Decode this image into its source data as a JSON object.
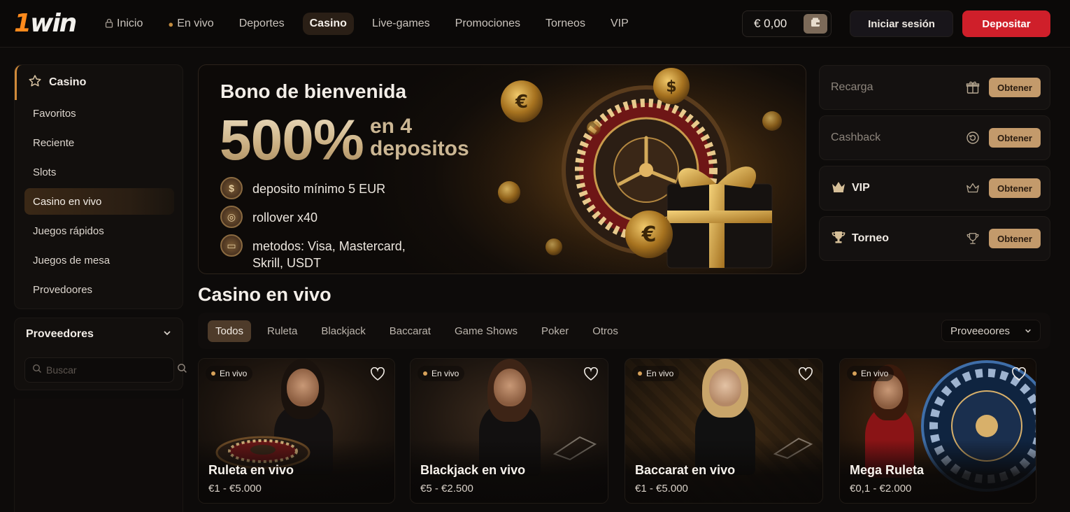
{
  "header": {
    "logo_text_one": "1",
    "logo_text_win": "win",
    "nav": [
      {
        "label": "Inicio",
        "icon": "lock-icon"
      },
      {
        "label": "En vivo",
        "icon": "live-icon"
      },
      {
        "label": "Deportes"
      },
      {
        "label": "Casino",
        "active": true
      },
      {
        "label": "Live-games"
      },
      {
        "label": "Promociones"
      },
      {
        "label": "Torneos"
      },
      {
        "label": "VIP"
      }
    ],
    "balance": "€ 0,00",
    "login_label": "Iniciar sesión",
    "deposit_label": "Depositar"
  },
  "sidebar": {
    "title": "Casino",
    "items": [
      {
        "label": "Favoritos"
      },
      {
        "label": "Reciente"
      },
      {
        "label": "Slots"
      },
      {
        "label": "Casino en vivo",
        "active": true
      },
      {
        "label": "Juegos rápidos"
      },
      {
        "label": "Juegos de mesa"
      },
      {
        "label": "Provedoores"
      }
    ],
    "providers_title": "Proveedores",
    "search_placeholder": "Buscar"
  },
  "hero": {
    "title": "Bono de bienvenida",
    "big": "500%",
    "sub_line1": "en 4",
    "sub_line2": "depositos",
    "rows": [
      {
        "icon": "coin-icon",
        "text": "deposito mínimo 5 EUR"
      },
      {
        "icon": "target-icon",
        "text": "rollover x40"
      },
      {
        "icon": "card-icon",
        "text": "metodos: Visa, Mastercard,",
        "text2": "Skrill, USDT"
      }
    ]
  },
  "promos": [
    {
      "label": "Recarga",
      "faded": true,
      "icon": "gift-icon",
      "button": "Obtener"
    },
    {
      "label": "Cashback",
      "faded": true,
      "icon": "cashback-icon",
      "button": "Obtener"
    },
    {
      "label": "VIP",
      "faded": false,
      "icon": "crown-icon",
      "button": "Obtener"
    },
    {
      "label": "Torneo",
      "faded": false,
      "icon": "trophy-icon",
      "button": "Obtener"
    }
  ],
  "live_section": {
    "title": "Casino en vivo",
    "tabs": [
      {
        "label": "Todos",
        "active": true
      },
      {
        "label": "Ruleta"
      },
      {
        "label": "Blackjack"
      },
      {
        "label": "Baccarat"
      },
      {
        "label": "Game Shows"
      },
      {
        "label": "Poker"
      },
      {
        "label": "Otros"
      }
    ],
    "provider_select": "Proveeoores",
    "games": [
      {
        "badge": "En vivo",
        "title": "Ruleta en vivo",
        "range": "€1 - €5.000"
      },
      {
        "badge": "En vivo",
        "title": "Blackjack en vivo",
        "range": "€5 - €2.500"
      },
      {
        "badge": "En vivo",
        "title": "Baccarat en vivo",
        "range": "€1 - €5.000"
      },
      {
        "badge": "En vivo",
        "title": "Mega Ruleta",
        "range": "€0,1 - €2.000"
      }
    ]
  },
  "colors": {
    "accent_gold": "#c39a6b",
    "deposit_red": "#cf1f2a",
    "background": "#0d0b0a"
  }
}
